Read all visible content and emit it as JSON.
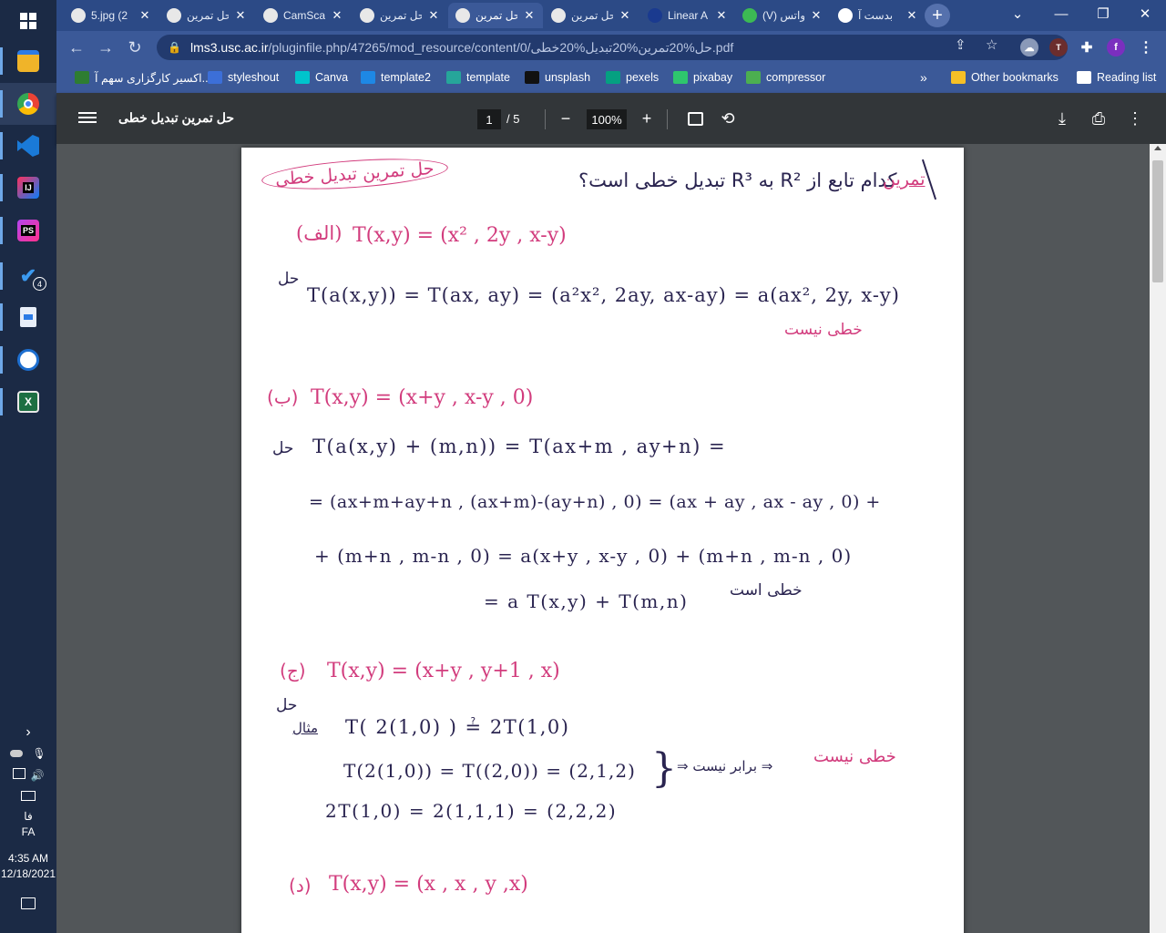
{
  "taskbar": {
    "time": "4:35 AM",
    "date": "12/18/2021",
    "lang_short": "فا",
    "lang": "FA",
    "todo_badge": "4",
    "apps": [
      {
        "name": "start-icon",
        "glyph": ""
      },
      {
        "name": "file-explorer-icon",
        "glyph": ""
      },
      {
        "name": "chrome-icon",
        "glyph": ""
      },
      {
        "name": "vscode-icon",
        "glyph": ""
      },
      {
        "name": "intellij-icon",
        "glyph": "IJ"
      },
      {
        "name": "phpstorm-icon",
        "glyph": "PS"
      },
      {
        "name": "todo-icon",
        "glyph": "✔"
      },
      {
        "name": "notepad-icon",
        "glyph": ""
      },
      {
        "name": "matlab-icon",
        "glyph": ""
      },
      {
        "name": "excel-icon",
        "glyph": "X"
      }
    ]
  },
  "tabs": [
    {
      "title": "5.jpg (2",
      "fav_color": "#e8e8e8"
    },
    {
      "title": "حل تمرین",
      "fav_color": "#e8e8e8"
    },
    {
      "title": "CamSca",
      "fav_color": "#e8e8e8"
    },
    {
      "title": "حل تمرین",
      "fav_color": "#e8e8e8"
    },
    {
      "title": "حل تمرین",
      "fav_color": "#e8e8e8"
    },
    {
      "title": "حل تمرین",
      "fav_color": "#e8e8e8"
    },
    {
      "title": "Linear A",
      "fav_color": "#1a3a8f"
    },
    {
      "title": "(V) واتس",
      "fav_color": "#3cba54"
    },
    {
      "title": "بدست آ",
      "fav_color": "#ffffff"
    }
  ],
  "address": {
    "domain": "lms3.usc.ac.ir",
    "path": "/pluginfile.php/47265/mod_resource/content/0/حل%20تمرین%20تبدیل%20خطی.pdf"
  },
  "bookmarks": [
    {
      "label": "اکسیر کارگزاری سهم آ...",
      "color": "#2e7d32"
    },
    {
      "label": "styleshout",
      "color": "#3c6fd8"
    },
    {
      "label": "Canva",
      "color": "#00c4cc"
    },
    {
      "label": "template2",
      "color": "#1e88e5"
    },
    {
      "label": "template",
      "color": "#26a69a"
    },
    {
      "label": "unsplash",
      "color": "#111111"
    },
    {
      "label": "pexels",
      "color": "#05a081"
    },
    {
      "label": "pixabay",
      "color": "#2ec66d"
    },
    {
      "label": "compressor",
      "color": "#4caf50"
    },
    {
      "label": "Other bookmarks",
      "color": "#f6c026"
    },
    {
      "label": "Reading list",
      "color": "#ffffff"
    }
  ],
  "pdf": {
    "title": "حل تمرین تبدیل خطی",
    "page": "1",
    "total": "/  5",
    "zoom": "100%"
  },
  "content": {
    "header_left": "حل تمرین تبدیل خطی",
    "header_right": "تمرین",
    "question": "کدام تابع از R² به R³ تبدیل خطی است؟",
    "a_label": "(الف)",
    "a_func": "T(x,y) = (x² , 2y , x-y)",
    "a_sol_label": "حل",
    "a_sol": "T(a(x,y)) = T(ax, ay) = (a²x², 2ay, ax-ay) = a(ax², 2y, x-y)",
    "a_result": "خطی نیست",
    "b_label": "(ب)",
    "b_func": "T(x,y) = (x+y , x-y , 0)",
    "b_sol_label": "حل",
    "b_line1": "T(a(x,y) + (m,n)) = T(ax+m , ay+n) =",
    "b_line2": "= (ax+m+ay+n , (ax+m)-(ay+n) , 0) = (ax + ay , ax - ay , 0) +",
    "b_line3": "+ (m+n , m-n , 0) = a(x+y , x-y , 0) + (m+n , m-n , 0)",
    "b_line4": "= a T(x,y) + T(m,n)",
    "b_result": "خطی است",
    "c_label": "(ج)",
    "c_func": "T(x,y) = (x+y , y+1 , x)",
    "c_sol_label": "حل",
    "c_example": "مثال",
    "c_line1": "T( 2(1,0) ) ≟ 2T(1,0)",
    "c_line2": "T(2(1,0)) = T((2,0)) = (2,1,2)",
    "c_line3": "2T(1,0) = 2(1,1,1) = (2,2,2)",
    "c_cmp": "⇒ برابر نیست ⇒",
    "c_result": "خطی نیست",
    "d_label": "(د)",
    "d_func": "T(x,y) = (x , x , y ,x)"
  }
}
